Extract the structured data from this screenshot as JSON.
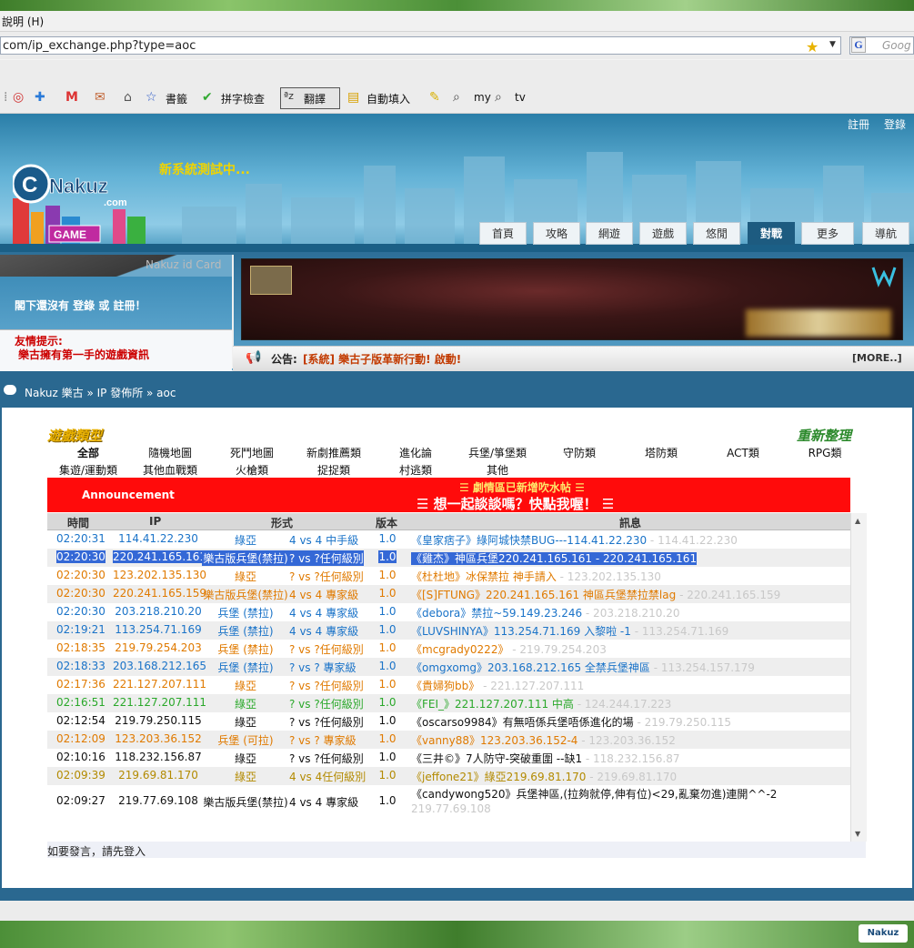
{
  "browser": {
    "menu_text": "說明 (H)",
    "url": "com/ip_exchange.php?type=aoc",
    "search_placeholder": "Goog",
    "toolbar": {
      "bookmarks": "書籤",
      "spellcheck": "拼字檢查",
      "translate": "翻譯",
      "autofill": "自動填入",
      "my": "my",
      "tv": "tv"
    }
  },
  "site": {
    "register": "註冊",
    "login": "登錄",
    "slogan": "新系統測試中...",
    "logo_text": "Nakuz",
    "logo_domain": ".com",
    "logo_game": "GAME",
    "nav": [
      "首頁",
      "攻略",
      "網遊",
      "遊戲",
      "悠閒",
      "對戰",
      "更多",
      "導航"
    ],
    "nav_active": "對戰"
  },
  "idcard": {
    "title": "Nakuz id Card",
    "not_logged_in": "閣下還沒有 登錄 或 註冊！",
    "tips_title": "友情提示:",
    "tips_text": "樂古擁有第一手的遊戲資訊"
  },
  "announcement_bar": {
    "label": "公告:",
    "text": "[系統] 樂古子版革新行動! 啟動!",
    "more": "[MORE..]"
  },
  "breadcrumb": "Nakuz 樂古 » IP 發佈所 » aoc",
  "categories": {
    "title": "遊戲類型",
    "refresh": "重新整理",
    "row1": [
      "全部",
      "隨機地圖",
      "死鬥地圖",
      "新劇推薦類",
      "進化論",
      "兵堡/箏堡類",
      "守防類",
      "塔防類",
      "ACT類",
      "RPG類"
    ],
    "row2": [
      "集遊/運動類",
      "其他血戰類",
      "火槍類",
      "捉捉類",
      "村逃類",
      "其他"
    ],
    "selected": "全部"
  },
  "notice": {
    "label": "Announcement",
    "line1": "☰ 劇情區已新增吹水帖 ☰",
    "line2": "☰ 想一起談談嗎？快點我喔！ ☰"
  },
  "table": {
    "headers": [
      "時間",
      "IP",
      "形式",
      "版本",
      "訊息"
    ],
    "rows": [
      {
        "time": "02:20:31",
        "ip": "114.41.22.230",
        "map": "綠亞",
        "mode": "4 vs 4  中手級",
        "ver": "1.0",
        "msg": "《皇家痞子》綠阿城快禁BUG---114.41.22.230",
        "tail": " - 114.41.22.230",
        "color": "#1a73c8"
      },
      {
        "time": "02:20:30",
        "ip": "220.241.165.161",
        "map": "樂古版兵堡(禁拉)",
        "mode": "? vs ?任何級別",
        "ver": "1.0",
        "msg": "《雞杰》神區兵堡220.241.165.161 - 220.241.165.161",
        "tail": "",
        "color": "#1a73c8",
        "hl": true
      },
      {
        "time": "02:20:30",
        "ip": "123.202.135.130",
        "map": "綠亞",
        "mode": "? vs ?任何級別",
        "ver": "1.0",
        "msg": "《杜杜地》冰保禁拉 神手請入",
        "tail": " - 123.202.135.130",
        "color": "#e07a00"
      },
      {
        "time": "02:20:30",
        "ip": "220.241.165.159",
        "map": "樂古版兵堡(禁拉)",
        "mode": "4 vs 4  專家級",
        "ver": "1.0",
        "msg": "《[S]FTUNG》220.241.165.161 神區兵堡禁拉禁lag",
        "tail": " - 220.241.165.159",
        "color": "#e07a00"
      },
      {
        "time": "02:20:30",
        "ip": "203.218.210.20",
        "map": "兵堡 (禁拉)",
        "mode": "4 vs 4  專家級",
        "ver": "1.0",
        "msg": "《debora》禁拉~59.149.23.246",
        "tail": " - 203.218.210.20",
        "color": "#1a73c8"
      },
      {
        "time": "02:19:21",
        "ip": "113.254.71.169",
        "map": "兵堡 (禁拉)",
        "mode": "4 vs 4  專家級",
        "ver": "1.0",
        "msg": "《LUVSHINYA》113.254.71.169  入黎啦 -1",
        "tail": " - 113.254.71.169",
        "color": "#1a73c8"
      },
      {
        "time": "02:18:35",
        "ip": "219.79.254.203",
        "map": "兵堡 (禁拉)",
        "mode": "? vs ?任何級別",
        "ver": "1.0",
        "msg": "《mcgrady0222》",
        "tail": " - 219.79.254.203",
        "color": "#e07a00"
      },
      {
        "time": "02:18:33",
        "ip": "203.168.212.165",
        "map": "兵堡 (禁拉)",
        "mode": "? vs ?  專家級",
        "ver": "1.0",
        "msg": "《omgxomg》203.168.212.165 全禁兵堡神區",
        "tail": " - 113.254.157.179",
        "color": "#1a73c8"
      },
      {
        "time": "02:17:36",
        "ip": "221.127.207.111",
        "map": "綠亞",
        "mode": "? vs ?任何級別",
        "ver": "1.0",
        "msg": "《貴婦狗bb》",
        "tail": " - 221.127.207.111",
        "color": "#e07a00"
      },
      {
        "time": "02:16:51",
        "ip": "221.127.207.111",
        "map": "綠亞",
        "mode": "? vs ?任何級別",
        "ver": "1.0",
        "msg": "《FEI_》221.127.207.111 中高",
        "tail": " - 124.244.17.223",
        "color": "#2aa82a"
      },
      {
        "time": "02:12:54",
        "ip": "219.79.250.115",
        "map": "綠亞",
        "mode": "? vs ?任何級別",
        "ver": "1.0",
        "msg": "《oscarso9984》有無唔係兵堡唔係進化的場",
        "tail": " - 219.79.250.115",
        "color": "#111111"
      },
      {
        "time": "02:12:09",
        "ip": "123.203.36.152",
        "map": "兵堡 (可拉)",
        "mode": "? vs ?  專家級",
        "ver": "1.0",
        "msg": "《vanny88》123.203.36.152-4",
        "tail": " - 123.203.36.152",
        "color": "#e07a00"
      },
      {
        "time": "02:10:16",
        "ip": "118.232.156.87",
        "map": "綠亞",
        "mode": "? vs ?任何級別",
        "ver": "1.0",
        "msg": "《三井©》7人防守-突破重圍   --缺1",
        "tail": " - 118.232.156.87",
        "color": "#111111"
      },
      {
        "time": "02:09:39",
        "ip": "219.69.81.170",
        "map": "綠亞",
        "mode": "4 vs 4任何級別",
        "ver": "1.0",
        "msg": "《jeffone21》綠亞219.69.81.170",
        "tail": " - 219.69.81.170",
        "color": "#b38a00"
      },
      {
        "time": "02:09:27",
        "ip": "219.77.69.108",
        "map": "樂古版兵堡(禁拉)",
        "mode": "4 vs 4  專家級",
        "ver": "1.0",
        "msg": "《candywong520》兵堡神區,(拉夠就停,伸有位)<29,亂棄勿進)連開^^-2",
        "tail": "219.77.69.108",
        "color": "#111111"
      }
    ]
  },
  "login_note": "如要發言，請先登入",
  "footer_logo": "Nakuz"
}
